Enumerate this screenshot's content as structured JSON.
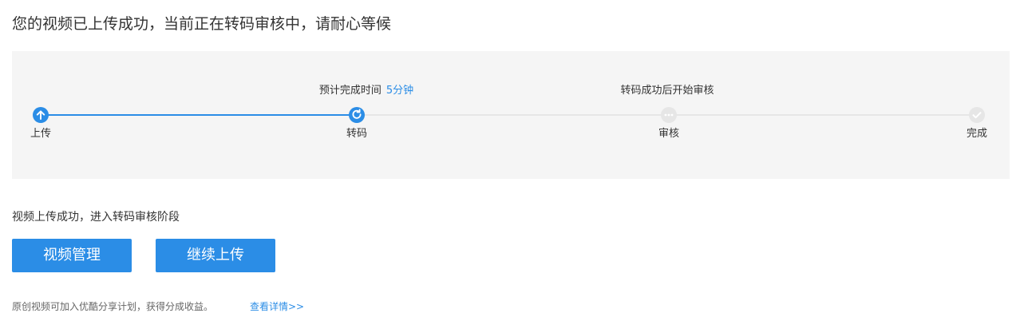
{
  "title": "您的视频已上传成功，当前正在转码审核中，请耐心等候",
  "progress": {
    "completed_fraction": 0.338,
    "steps": [
      {
        "label": "上传",
        "status": "done",
        "icon": "arrow-up-icon"
      },
      {
        "label": "转码",
        "status": "in-progress",
        "icon": "refresh-icon"
      },
      {
        "label": "审核",
        "status": "pending",
        "icon": "ellipsis-icon"
      },
      {
        "label": "完成",
        "status": "pending",
        "icon": "checkmark-icon"
      }
    ],
    "notes": {
      "transcode_estimate_label": "预计完成时间",
      "transcode_estimate_value": "5分钟",
      "review_note": "转码成功后开始审核"
    }
  },
  "status_message": "视频上传成功，进入转码审核阶段",
  "buttons": {
    "video_manage": "视频管理",
    "continue_upload": "继续上传"
  },
  "footer": {
    "text": "原创视频可加入优酷分享计划，获得分成收益。",
    "link": "查看详情>>"
  },
  "colors": {
    "accent": "#2b8de6",
    "pending": "#e6e6e6",
    "panel_background": "#f5f5f5"
  }
}
